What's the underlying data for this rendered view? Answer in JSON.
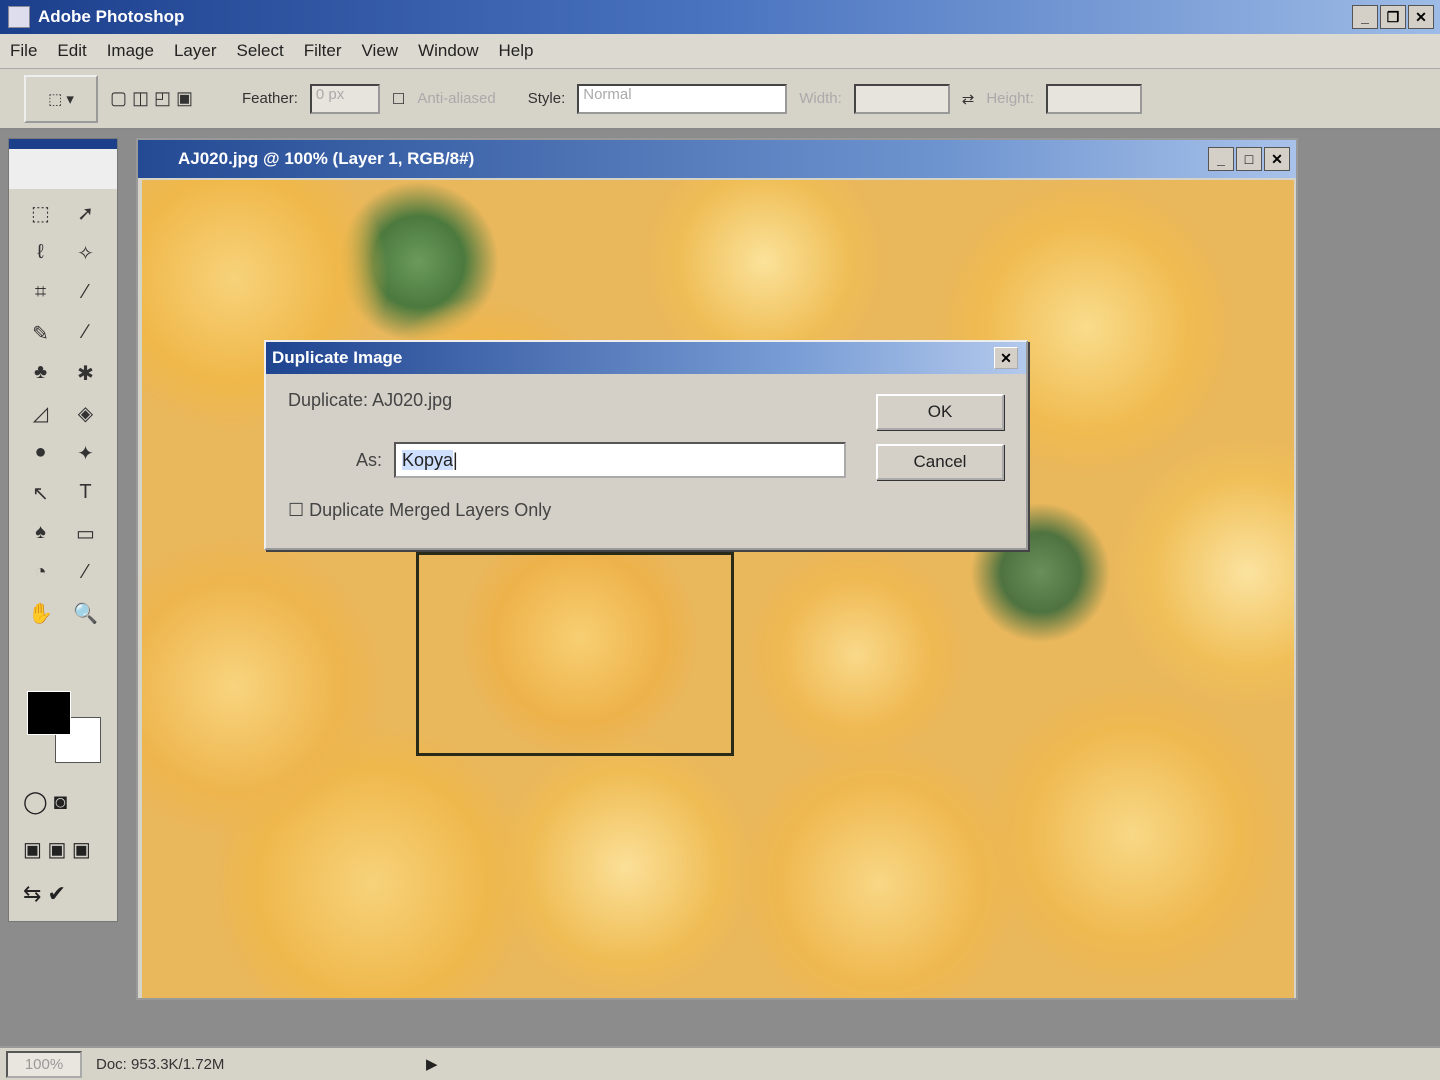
{
  "app": {
    "title": "Adobe Photoshop"
  },
  "menu": [
    "File",
    "Edit",
    "Image",
    "Layer",
    "Select",
    "Filter",
    "View",
    "Window",
    "Help"
  ],
  "options": {
    "feather_label": "Feather:",
    "feather_value": "0 px",
    "anti_alias_label": "Anti-aliased",
    "style_label": "Style:",
    "style_value": "Normal",
    "width_label": "Width:",
    "height_label": "Height:"
  },
  "document": {
    "title": "AJ020.jpg @ 100% (Layer 1, RGB/8#)"
  },
  "dialog": {
    "title": "Duplicate Image",
    "duplicate_label": "Duplicate:",
    "duplicate_name": "AJ020.jpg",
    "as_label": "As:",
    "as_value": "Kopya",
    "checkbox_label": "Duplicate Merged Layers Only",
    "ok": "OK",
    "cancel": "Cancel"
  },
  "status": {
    "zoom": "100%",
    "doc": "Doc: 953.3K/1.72M"
  },
  "tools": [
    "⬚",
    "➚",
    "ℓ",
    "✧",
    "⌗",
    "⁄",
    "✎",
    "∕",
    "♣",
    "✱",
    "◿",
    "◈",
    "●",
    "✦",
    "↖",
    "T",
    "♠",
    "▭",
    "◔",
    "⁄",
    "✋",
    "🔍"
  ]
}
